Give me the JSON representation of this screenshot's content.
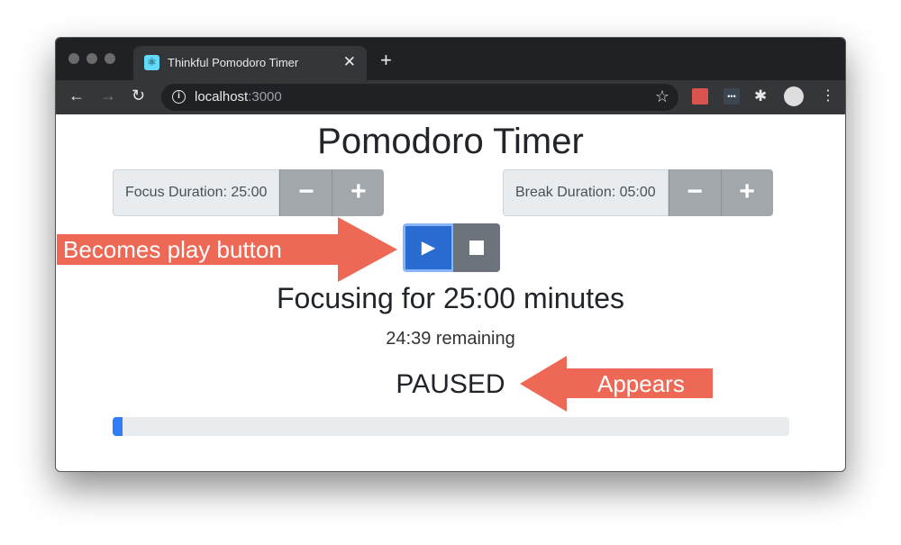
{
  "browser": {
    "tab_title": "Thinkful Pomodoro Timer",
    "url_host": "localhost",
    "url_port": ":3000",
    "icons": [
      "back-icon",
      "forward-icon",
      "reload-icon",
      "info-icon",
      "star-icon",
      "extension-icon",
      "puzzle-icon",
      "profile-icon",
      "menu-icon"
    ]
  },
  "app": {
    "title": "Pomodoro Timer",
    "focus": {
      "label": "Focus Duration: 25:00",
      "minus": "−",
      "plus": "+"
    },
    "break": {
      "label": "Break Duration: 05:00",
      "minus": "−",
      "plus": "+"
    },
    "play_glyph": "▶",
    "session": "Focusing for 25:00 minutes",
    "remaining": "24:39 remaining",
    "status": "PAUSED",
    "progress_percent": 1.4
  },
  "annotations": {
    "left": "Becomes play button",
    "right": "Appears",
    "color": "#ee6856"
  },
  "colors": {
    "primary": "#2a6bd1",
    "secondary": "#6c737b",
    "progress": "#2f7cf6"
  }
}
